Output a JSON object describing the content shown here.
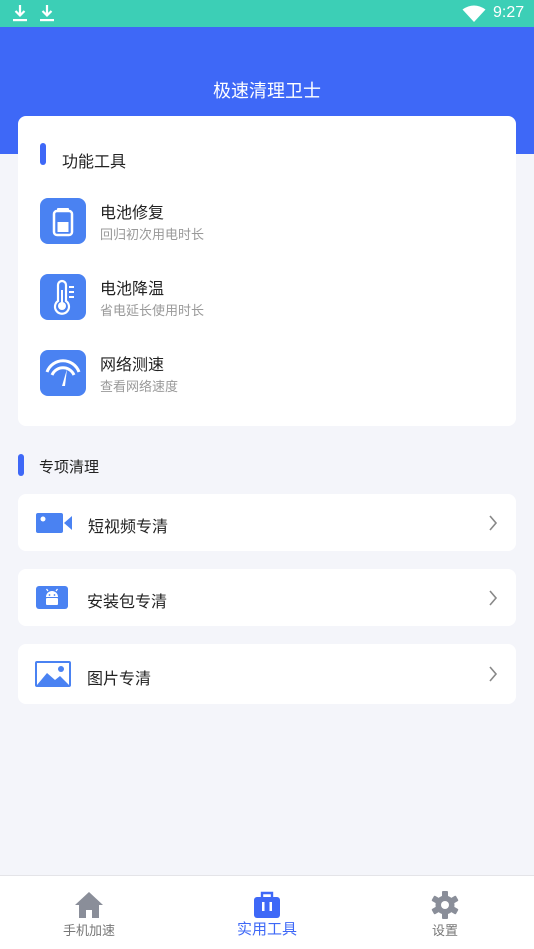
{
  "status_bar": {
    "time": "9:27",
    "icons": [
      "download-icon",
      "download-icon",
      "wifi-icon"
    ]
  },
  "header": {
    "title": "极速清理卫士"
  },
  "tools": {
    "section_title": "功能工具",
    "items": [
      {
        "name": "电池修复",
        "desc": "回归初次用电时长",
        "icon": "battery-icon"
      },
      {
        "name": "电池降温",
        "desc": "省电延长使用时长",
        "icon": "thermometer-icon"
      },
      {
        "name": "网络测速",
        "desc": "查看网络速度",
        "icon": "speedometer-icon"
      }
    ]
  },
  "cleaning": {
    "section_title": "专项清理",
    "items": [
      {
        "label": "短视频专清",
        "icon": "video-camera-icon"
      },
      {
        "label": "安装包专清",
        "icon": "android-package-icon"
      },
      {
        "label": "图片专清",
        "icon": "image-icon"
      }
    ]
  },
  "tabbar": {
    "tabs": [
      {
        "label": "手机加速",
        "icon": "home-icon",
        "active": false
      },
      {
        "label": "实用工具",
        "icon": "toolbox-icon",
        "active": true
      },
      {
        "label": "设置",
        "icon": "gear-icon",
        "active": false
      }
    ]
  },
  "colors": {
    "status_bar": "#3ccfb6",
    "primary": "#3e68f7",
    "icon_blue": "#4a82f2",
    "background": "#f4f5fa"
  }
}
